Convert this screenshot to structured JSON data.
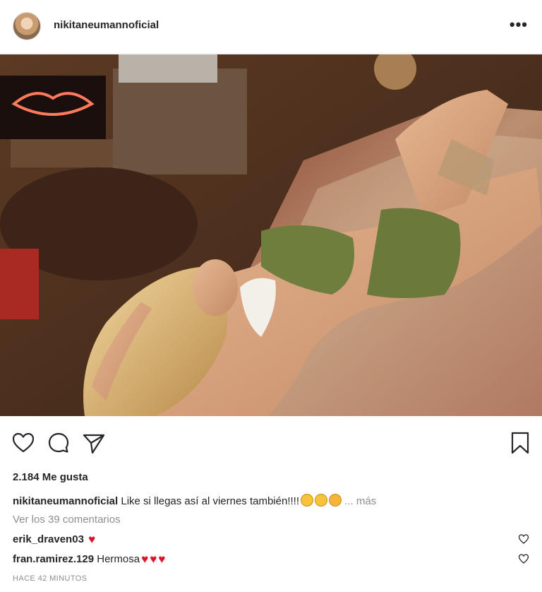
{
  "post": {
    "username": "nikitaneumannoficial",
    "more_icon": "•••"
  },
  "actions": {
    "like_icon": "heart-outline-icon",
    "comment_icon": "comment-bubble-icon",
    "share_icon": "paper-plane-icon",
    "save_icon": "bookmark-icon"
  },
  "likes": "2.184 Me gusta",
  "caption": {
    "username": "nikitaneumannoficial",
    "text": "Like si llegas así al viernes también!!!!",
    "more": "... más"
  },
  "view_all": "Ver los 39 comentarios",
  "comments": [
    {
      "username": "erik_draven03",
      "text": ""
    },
    {
      "username": "fran.ramirez.129",
      "text": "Hermosa"
    }
  ],
  "timestamp": "HACE 42 MINUTOS",
  "colors": {
    "heart": "#e0112b",
    "muted": "#8e8e8e",
    "text": "#262626"
  }
}
